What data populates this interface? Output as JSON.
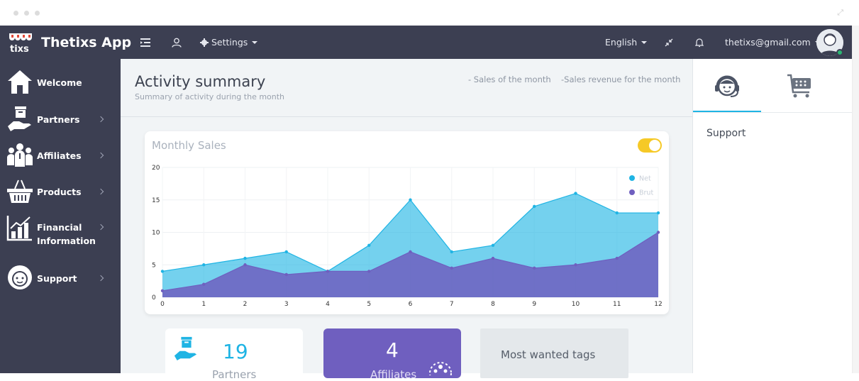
{
  "app": {
    "name": "Thetixs App",
    "logo_text": "tixs"
  },
  "topbar": {
    "settings_label": "Settings",
    "language_label": "English",
    "user_email": "thetixs@gmail.com"
  },
  "sidebar": {
    "items": [
      {
        "label": "Welcome",
        "icon": "home-icon"
      },
      {
        "label": "Partners",
        "icon": "partners-icon"
      },
      {
        "label": "Affiliates",
        "icon": "affiliates-icon"
      },
      {
        "label": "Products",
        "icon": "basket-icon"
      },
      {
        "label": "Financial",
        "label2": "Information",
        "icon": "chart-icon"
      },
      {
        "label": "Support",
        "icon": "support-icon"
      }
    ]
  },
  "page": {
    "title": "Activity summary",
    "subtitle": "Summary of activity during the month",
    "link_sales": "- Sales of the month",
    "link_revenue": "-Sales revenue for the month"
  },
  "chart_data": {
    "type": "area",
    "title": "Monthly Sales",
    "x": [
      0,
      1,
      2,
      3,
      4,
      5,
      6,
      7,
      8,
      9,
      10,
      11,
      12
    ],
    "series": [
      {
        "name": "Net",
        "color": "#1fb4e4",
        "values": [
          4,
          5,
          6,
          7,
          4,
          8,
          15,
          7,
          8,
          14,
          16,
          13,
          13
        ]
      },
      {
        "name": "Brut",
        "color": "#6f5fbf",
        "values": [
          1,
          2,
          5,
          3.5,
          4,
          4,
          7,
          4.5,
          6,
          4.5,
          5,
          6,
          10
        ]
      }
    ],
    "xlim": [
      0,
      12
    ],
    "ylim": [
      0,
      20
    ],
    "yticks": [
      0,
      5,
      10,
      15,
      20
    ],
    "xticks": [
      0,
      1,
      2,
      3,
      4,
      5,
      6,
      7,
      8,
      9,
      10,
      11,
      12
    ],
    "grid": true,
    "legend": "top-right"
  },
  "tiles": [
    {
      "number": "19",
      "label": "Partners"
    },
    {
      "number": "4",
      "label": "Affiliates"
    },
    {
      "label": "Most wanted tags"
    }
  ],
  "right_panel": {
    "section_title": "Support"
  },
  "colors": {
    "sidebar": "#3c3f52",
    "accent": "#1fb4e4",
    "purple": "#6f5fbf",
    "toggle": "#f6c927"
  }
}
